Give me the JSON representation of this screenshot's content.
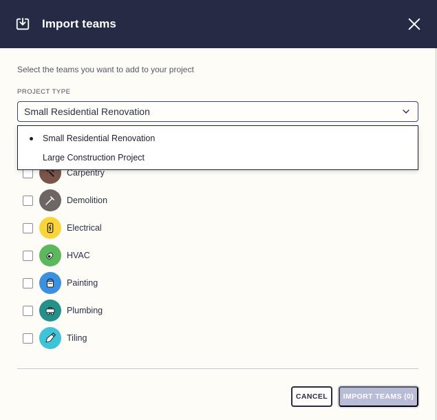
{
  "header": {
    "title": "Import teams",
    "icon": "import-tray-icon",
    "close_icon": "close-icon",
    "background": "#252a45"
  },
  "intro": {
    "subtitle": "Select the teams you want to add to your project"
  },
  "project_type": {
    "label": "PROJECT TYPE",
    "selected": "Small Residential Renovation",
    "options": [
      {
        "label": "Small Residential Renovation",
        "selected": true
      },
      {
        "label": "Large Construction Project",
        "selected": false
      }
    ]
  },
  "teams": [
    {
      "label": "Carpentry",
      "icon": "hammer-saw-icon",
      "color": "#7a5548",
      "checked": false
    },
    {
      "label": "Demolition",
      "icon": "jackhammer-icon",
      "color": "#6e6665",
      "checked": false
    },
    {
      "label": "Electrical",
      "icon": "lightning-plug-icon",
      "color": "#f9d43a",
      "checked": false
    },
    {
      "label": "HVAC",
      "icon": "fan-duct-icon",
      "color": "#5cb85c",
      "checked": false
    },
    {
      "label": "Painting",
      "icon": "paint-bucket-icon",
      "color": "#3d8fe0",
      "checked": false
    },
    {
      "label": "Plumbing",
      "icon": "pipe-wrench-icon",
      "color": "#23908a",
      "checked": false
    },
    {
      "label": "Tiling",
      "icon": "trowel-icon",
      "color": "#3fc3d8",
      "checked": false
    }
  ],
  "footer": {
    "cancel_label": "CANCEL",
    "import_label": "IMPORT TEAMS (0)"
  }
}
